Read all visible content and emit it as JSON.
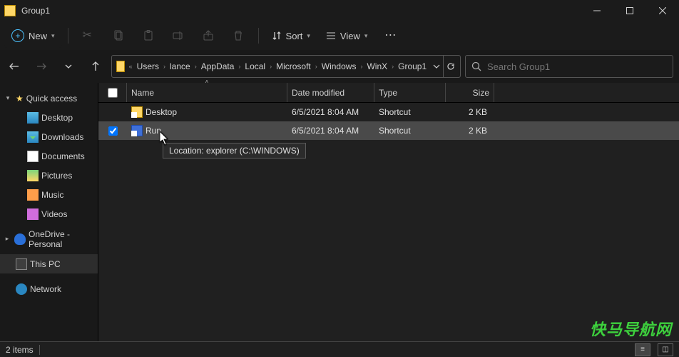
{
  "window": {
    "title": "Group1"
  },
  "toolbar": {
    "new_label": "New",
    "sort_label": "Sort",
    "view_label": "View"
  },
  "breadcrumb": {
    "parts": [
      "Users",
      "lance",
      "AppData",
      "Local",
      "Microsoft",
      "Windows",
      "WinX",
      "Group1"
    ]
  },
  "search": {
    "placeholder": "Search Group1"
  },
  "sidebar": {
    "quick_access": "Quick access",
    "items": [
      {
        "label": "Desktop",
        "icon": "desk"
      },
      {
        "label": "Downloads",
        "icon": "down"
      },
      {
        "label": "Documents",
        "icon": "doc"
      },
      {
        "label": "Pictures",
        "icon": "pic"
      },
      {
        "label": "Music",
        "icon": "music"
      },
      {
        "label": "Videos",
        "icon": "video"
      }
    ],
    "onedrive": "OneDrive - Personal",
    "thispc": "This PC",
    "network": "Network"
  },
  "columns": {
    "name": "Name",
    "mod": "Date modified",
    "type": "Type",
    "size": "Size"
  },
  "rows": [
    {
      "name": "Desktop",
      "mod": "6/5/2021 8:04 AM",
      "type": "Shortcut",
      "size": "2 KB",
      "selected": false,
      "iconcls": ""
    },
    {
      "name": "Run",
      "mod": "6/5/2021 8:04 AM",
      "type": "Shortcut",
      "size": "2 KB",
      "selected": true,
      "iconcls": "run"
    }
  ],
  "tooltip": "Location: explorer (C:\\WINDOWS)",
  "status": {
    "count": "2 items"
  },
  "watermark": "快马导航网"
}
